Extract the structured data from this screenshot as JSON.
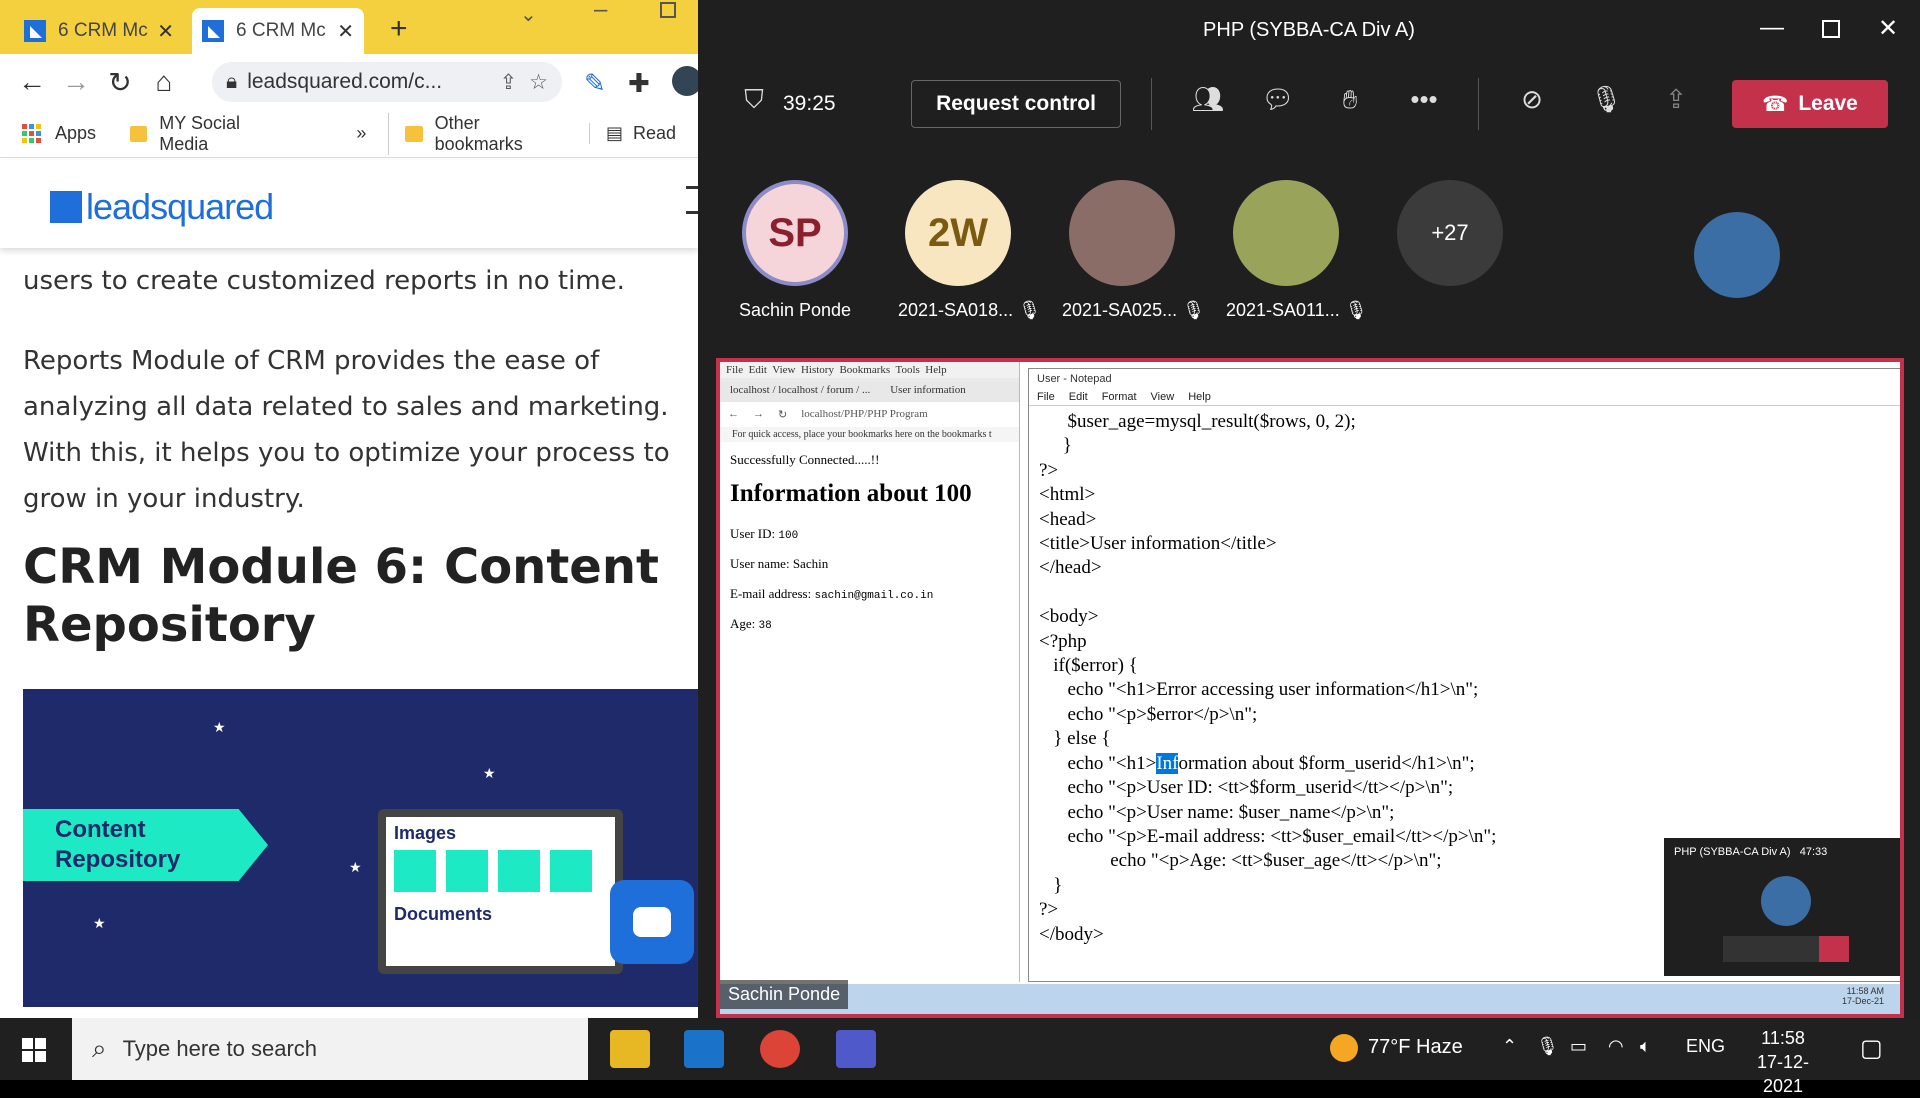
{
  "chrome": {
    "tabs": [
      {
        "label": "6 CRM Mc"
      },
      {
        "label": "6 CRM Mc"
      }
    ],
    "url": "leadsquared.com/c...",
    "bookmarks": {
      "apps": "Apps",
      "social": "MY Social Media",
      "more": "»",
      "other": "Other bookmarks",
      "reading": "Read"
    },
    "logo": "leadsquared",
    "content": {
      "para1": "users to create customized reports in no time.",
      "para2": "Reports Module of CRM provides the ease of analyzing all data related to sales and marketing. With this, it helps you to optimize your process to grow in your industry.",
      "heading": "CRM Module 6: Content Repository"
    },
    "banner": {
      "ribbon_line1": "Content",
      "ribbon_line2": "Repository",
      "images_label": "Images",
      "documents_label": "Documents"
    }
  },
  "teams": {
    "window_title": "PHP (SYBBA-CA Div A)",
    "timer": "39:25",
    "request_control": "Request control",
    "leave": "Leave",
    "participants": [
      {
        "initials": "SP",
        "name": "Sachin Ponde",
        "bg": "#f5d5d9",
        "fg": "#8a1f2d"
      },
      {
        "initials": "2W",
        "name": "2021-SA018...",
        "bg": "#f7e6c0",
        "fg": "#7a5a10"
      },
      {
        "initials": "",
        "name": "2021-SA025...",
        "bg": "#8b6d67",
        "fg": "#fff"
      },
      {
        "initials": "",
        "name": "2021-SA011...",
        "bg": "#9aa35a",
        "fg": "#fff"
      },
      {
        "initials": "+27",
        "name": "",
        "bg": "#3b3b3b",
        "fg": "#fff"
      }
    ],
    "shared": {
      "firefox": {
        "menu": [
          "File",
          "Edit",
          "View",
          "History",
          "Bookmarks",
          "Tools",
          "Help"
        ],
        "tabs": [
          "localhost / localhost / forum / ...",
          "User information"
        ],
        "url": "localhost/PHP/PHP Program",
        "hint": "For quick access, place your bookmarks here on the bookmarks t",
        "connected": "Successfully Connected.....!!",
        "h1": "Information about 100",
        "userid_label": "User ID:",
        "userid": "100",
        "username_label": "User name:",
        "username": "Sachin",
        "email_label": "E-mail address:",
        "email": "sachin@gmail.co.in",
        "age_label": "Age:",
        "age": "38"
      },
      "notepad": {
        "title": "User - Notepad",
        "menu": [
          "File",
          "Edit",
          "Format",
          "View",
          "Help"
        ],
        "code_before": "      $user_age=mysql_result($rows, 0, 2);\n     }\n?>\n<html>\n<head>\n<title>User information</title>\n</head>\n\n<body>\n<?php\n   if($error) {\n      echo \"<h1>Error accessing user information</h1>\\n\";\n      echo \"<p>$error</p>\\n\";\n   } else {\n      echo \"<h1>",
        "code_selected": "Inf",
        "code_after": "ormation about $form_userid</h1>\\n\";\n      echo \"<p>User ID: <tt>$form_userid</tt></p>\\n\";\n      echo \"<p>User name: $user_name</p>\\n\";\n      echo \"<p>E-mail address: <tt>$user_email</tt></p>\\n\";\n               echo \"<p>Age: <tt>$user_age</tt></p>\\n\";\n   }\n?>\n</body>"
      },
      "mini_call": {
        "title": "PHP (SYBBA-CA Div A)",
        "time": "47:33"
      },
      "inner_clock": {
        "time": "11:58 AM",
        "date": "17-Dec-21"
      },
      "presenter": "Sachin Ponde"
    }
  },
  "taskbar": {
    "search_placeholder": "Type here to search",
    "weather": "77°F  Haze",
    "lang": "ENG",
    "time": "11:58",
    "date": "17-12-2021"
  }
}
